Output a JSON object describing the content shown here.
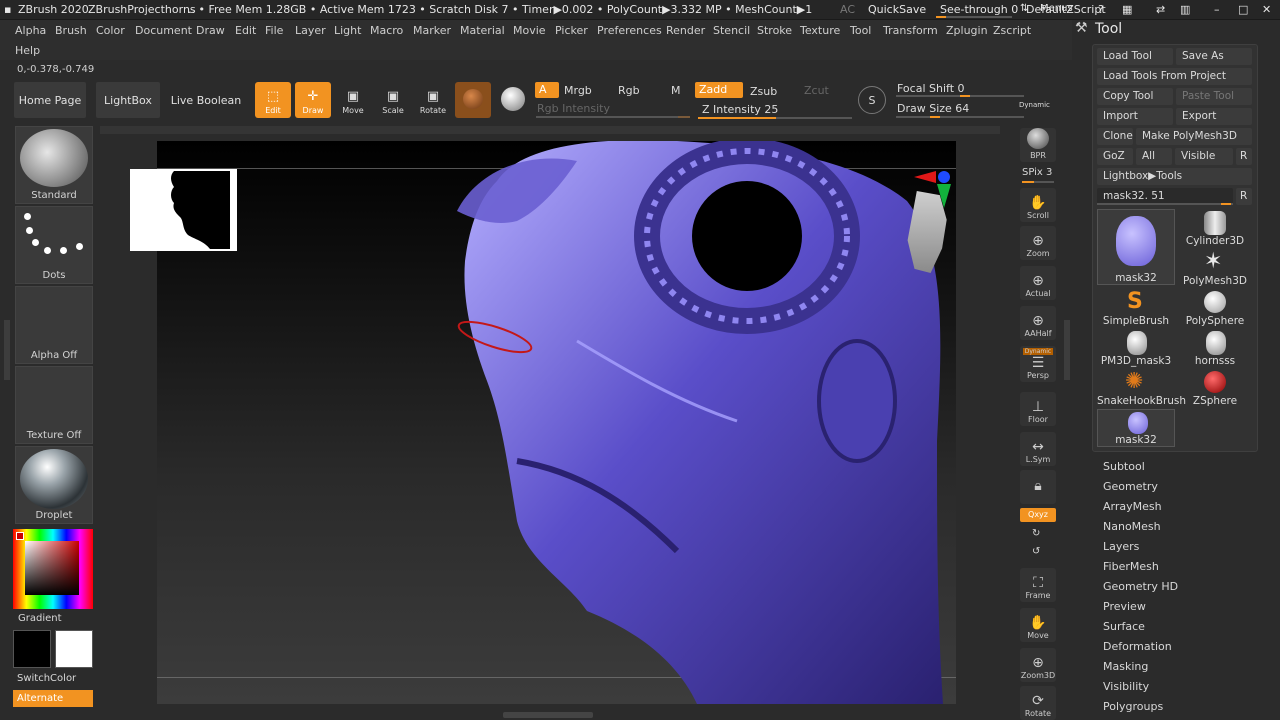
{
  "titlebar": {
    "app": "ZBrush 2020",
    "project": "ZBrushProjecthorns",
    "mem": ".. • Free Mem 1.28GB • Active Mem 1723 • Scratch Disk 7 • Timer▶0.002 • PolyCount▶3.332 MP • MeshCount▶1",
    "ac": "AC",
    "quicksave": "QuickSave",
    "seethrough": "See-through 0",
    "menus": "Menus",
    "zscript": "DefaultZScript"
  },
  "menubar": {
    "items": [
      "Alpha",
      "Brush",
      "Color",
      "Document",
      "Draw",
      "Edit",
      "File",
      "Layer",
      "Light",
      "Macro",
      "Marker",
      "Material",
      "Movie",
      "Picker",
      "Preferences",
      "Render",
      "Stencil",
      "Stroke",
      "Texture",
      "Tool",
      "Transform",
      "Zplugin",
      "Zscript"
    ],
    "help": "Help"
  },
  "coords": "0,-0.378,-0.749",
  "toolbar": {
    "home": "Home Page",
    "lightbox": "LightBox",
    "liveboolean": "Live Boolean",
    "edit": "Edit",
    "draw": "Draw",
    "move": "Move",
    "scale": "Scale",
    "rotate": "Rotate",
    "a": "A",
    "mrgb": "Mrgb",
    "rgb": "Rgb",
    "m": "M",
    "zadd": "Zadd",
    "zsub": "Zsub",
    "zcut": "Zcut",
    "rgb_intensity": "Rgb Intensity",
    "z_intensity": "Z Intensity 25",
    "focal_shift": "Focal Shift 0",
    "draw_size": "Draw Size 64",
    "dynamic": "Dynamic"
  },
  "left": {
    "brush": "Standard",
    "stroke": "Dots",
    "alpha": "Alpha Off",
    "texture": "Texture Off",
    "material": "Droplet",
    "gradient": "Gradient",
    "switchcolor": "SwitchColor",
    "alternate": "Alternate"
  },
  "right": {
    "bpr": "BPR",
    "spix": "SPix 3",
    "scroll": "Scroll",
    "zoom": "Zoom",
    "actual": "Actual",
    "aahalf": "AAHalf",
    "dynamic": "Dynamic",
    "persp": "Persp",
    "floor": "Floor",
    "lsym": "L.Sym",
    "xyz": "Qxyz",
    "frame": "Frame",
    "move": "Move",
    "zoom3d": "Zoom3D",
    "rotate": "Rotate"
  },
  "tool": {
    "title": "Tool",
    "load": "Load Tool",
    "saveas": "Save As",
    "loadproject": "Load Tools From Project",
    "copy": "Copy Tool",
    "paste": "Paste Tool",
    "import": "Import",
    "export": "Export",
    "clone": "Clone",
    "makepoly": "Make PolyMesh3D",
    "goz": "GoZ",
    "all": "All",
    "visible": "Visible",
    "r": "R",
    "lightboxtools": "Lightbox▶Tools",
    "mask": "mask32. 51",
    "items": [
      "mask32",
      "Cylinder3D",
      "PolyMesh3D",
      "SimpleBrush",
      "PolySphere",
      "PM3D_mask3",
      "hornsss",
      "SnakeHookBrush",
      "ZSphere",
      "mask32"
    ]
  },
  "subpalettes": [
    "Subtool",
    "Geometry",
    "ArrayMesh",
    "NanoMesh",
    "Layers",
    "FiberMesh",
    "Geometry HD",
    "Preview",
    "Surface",
    "Deformation",
    "Masking",
    "Visibility",
    "Polygroups"
  ],
  "colors": {
    "accent": "#f29321",
    "bg": "#2b2b2b",
    "panel": "#3a3a3a",
    "model": "#6b5fd8"
  }
}
